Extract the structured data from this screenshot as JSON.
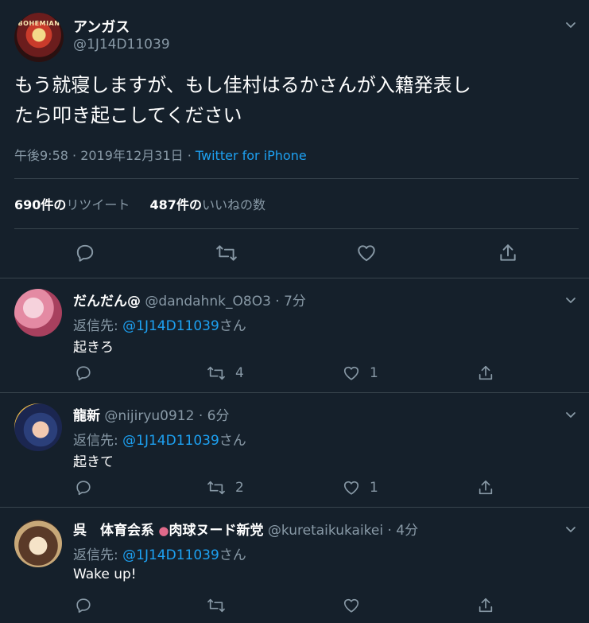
{
  "tweet": {
    "name": "アンガス",
    "handle": "@1J14D11039",
    "avatar_text": "BOHEMIAN",
    "text_line1": "もう就寝しますが、もし佳村はるかさんが入籍発表し",
    "text_line2": "たら叩き起こしてください",
    "time": "午後9:58 · 2019年12月31日 · ",
    "source": "Twitter for iPhone",
    "retweets_count": "690",
    "retweets_unit": "件の",
    "retweets_label": "リツイート",
    "likes_count": "487",
    "likes_unit": "件の",
    "likes_label": "いいねの数"
  },
  "replies": [
    {
      "name": "だんだん@",
      "handle": "@dandahnk_O8O3",
      "time": "· 7分",
      "reply_to_label": "返信先: ",
      "reply_to": "@1J14D11039",
      "reply_to_suffix": "さん",
      "text": "起きろ",
      "retweets": "4",
      "likes": "1"
    },
    {
      "name": "龍新",
      "handle": "@nijiryu0912",
      "time": "· 6分",
      "reply_to_label": "返信先: ",
      "reply_to": "@1J14D11039",
      "reply_to_suffix": "さん",
      "text": "起きて",
      "retweets": "2",
      "likes": "1"
    },
    {
      "name": "呉　体育会系",
      "name_tail": "肉球ヌード新党",
      "handle": "@kuretaikukaikei",
      "time": "· 4分",
      "reply_to_label": "返信先: ",
      "reply_to": "@1J14D11039",
      "reply_to_suffix": "さん",
      "text": "Wake up!",
      "retweets": "",
      "likes": ""
    }
  ],
  "icons": {
    "reply": "reply-icon",
    "retweet": "retweet-icon",
    "like": "heart-icon",
    "share": "share-icon",
    "menu": "chevron-down-icon"
  },
  "colors": {
    "background": "#15202b",
    "muted": "#8899a6",
    "link": "#1da1f2",
    "divider": "#38444d"
  }
}
